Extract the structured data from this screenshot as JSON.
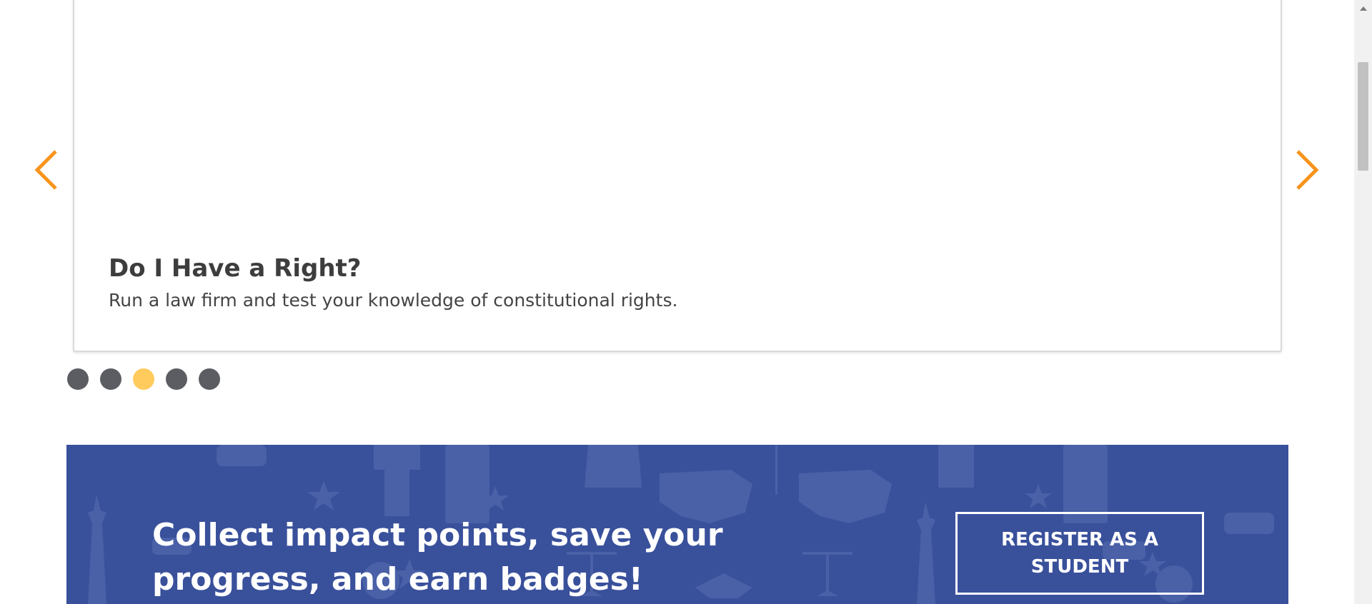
{
  "carousel": {
    "slide_title": "Do I Have a Right?",
    "slide_description": "Run a law firm and test your knowledge of constitutional rights.",
    "prev_icon": "chevron-left-icon",
    "next_icon": "chevron-right-icon",
    "arrow_color": "#f7941d",
    "dots": {
      "count": 5,
      "active_index": 2,
      "active_color": "#ffcb5c",
      "inactive_color": "#5b5d63"
    }
  },
  "banner": {
    "heading": "Collect impact points, save your progress, and earn badges!",
    "button_label": "REGISTER AS A STUDENT",
    "background_color": "#39509b",
    "pattern_icons": [
      "statue-of-liberty-icon",
      "usa-map-icon",
      "star-icon",
      "scales-of-justice-icon",
      "money-bag-icon",
      "pillar-icon",
      "book-icon",
      "scroll-icon",
      "eagle-icon"
    ]
  },
  "scrollbar": {
    "up_icon": "scroll-up-arrow-icon"
  }
}
